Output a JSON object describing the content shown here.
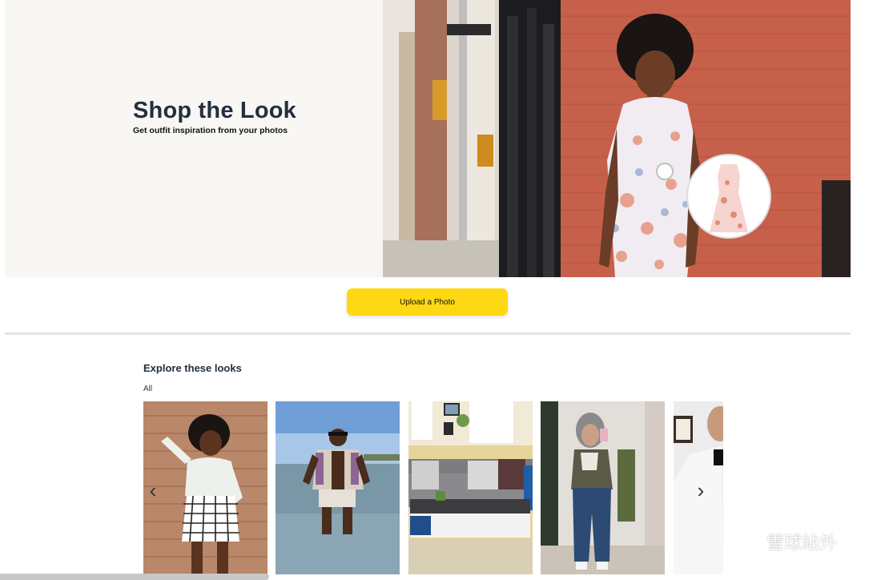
{
  "hero": {
    "title": "Shop the Look",
    "subtitle": "Get outfit inspiration from your photos"
  },
  "upload": {
    "label": "Upload a Photo"
  },
  "explore": {
    "heading": "Explore these looks",
    "filter": "All",
    "cards": [
      {
        "subject": "woman-white-top-brick-wall"
      },
      {
        "subject": "man-shirt-in-sea"
      },
      {
        "subject": "living-room-sofa"
      },
      {
        "subject": "woman-mirror-selfie-jeans"
      },
      {
        "subject": "man-white-jacket"
      }
    ]
  },
  "nav": {
    "prev_icon": "‹",
    "next_icon": "›"
  },
  "watermark": {
    "text": "雪球站外"
  },
  "colors": {
    "accent_button": "#ffd814",
    "hero_background": "#f8f7f4",
    "title_text": "#232f3e"
  }
}
